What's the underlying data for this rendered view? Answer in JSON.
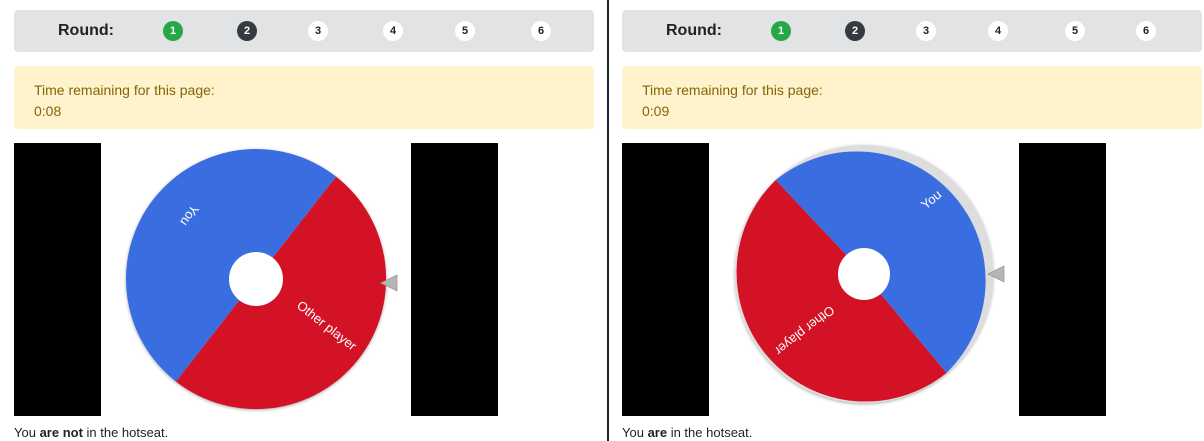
{
  "round_label": "Round:",
  "rounds": [
    "1",
    "2",
    "3",
    "4",
    "5",
    "6"
  ],
  "timer_label": "Time remaining for this page:",
  "colors": {
    "you": "#3a6ee0",
    "other": "#d31226",
    "round_done": "#28a745",
    "round_current": "#343a40"
  },
  "panels": [
    {
      "time": "0:08",
      "wheel": {
        "you_label": "You",
        "other_label": "Other player"
      },
      "status": {
        "pre": "You ",
        "bold": "are not",
        "post": " in the hotseat."
      }
    },
    {
      "time": "0:09",
      "wheel": {
        "you_label": "You",
        "other_label": "Other player"
      },
      "status": {
        "pre": "You ",
        "bold": "are",
        "post": " in the hotseat."
      }
    }
  ]
}
